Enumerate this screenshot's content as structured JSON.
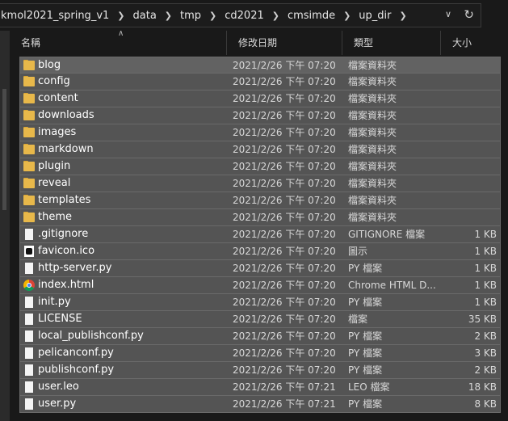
{
  "breadcrumb": [
    "kmol2021_spring_v1",
    "data",
    "tmp",
    "cd2021",
    "cmsimde",
    "up_dir"
  ],
  "columns": {
    "name": "名稱",
    "modified": "修改日期",
    "type": "類型",
    "size": "大小"
  },
  "files": [
    {
      "name": "blog",
      "modified": "2021/2/26 下午 07:20",
      "type": "檔案資料夾",
      "size": "",
      "icon": "folder-icon"
    },
    {
      "name": "config",
      "modified": "2021/2/26 下午 07:20",
      "type": "檔案資料夾",
      "size": "",
      "icon": "folder-icon"
    },
    {
      "name": "content",
      "modified": "2021/2/26 下午 07:20",
      "type": "檔案資料夾",
      "size": "",
      "icon": "folder-icon"
    },
    {
      "name": "downloads",
      "modified": "2021/2/26 下午 07:20",
      "type": "檔案資料夾",
      "size": "",
      "icon": "folder-icon"
    },
    {
      "name": "images",
      "modified": "2021/2/26 下午 07:20",
      "type": "檔案資料夾",
      "size": "",
      "icon": "folder-icon"
    },
    {
      "name": "markdown",
      "modified": "2021/2/26 下午 07:20",
      "type": "檔案資料夾",
      "size": "",
      "icon": "folder-icon"
    },
    {
      "name": "plugin",
      "modified": "2021/2/26 下午 07:20",
      "type": "檔案資料夾",
      "size": "",
      "icon": "folder-icon"
    },
    {
      "name": "reveal",
      "modified": "2021/2/26 下午 07:20",
      "type": "檔案資料夾",
      "size": "",
      "icon": "folder-icon"
    },
    {
      "name": "templates",
      "modified": "2021/2/26 下午 07:20",
      "type": "檔案資料夾",
      "size": "",
      "icon": "folder-icon"
    },
    {
      "name": "theme",
      "modified": "2021/2/26 下午 07:20",
      "type": "檔案資料夾",
      "size": "",
      "icon": "folder-icon"
    },
    {
      "name": ".gitignore",
      "modified": "2021/2/26 下午 07:20",
      "type": "GITIGNORE 檔案",
      "size": "1 KB",
      "icon": "file-icon"
    },
    {
      "name": "favicon.ico",
      "modified": "2021/2/26 下午 07:20",
      "type": "圖示",
      "size": "1 KB",
      "icon": "image-icon"
    },
    {
      "name": "http-server.py",
      "modified": "2021/2/26 下午 07:20",
      "type": "PY 檔案",
      "size": "1 KB",
      "icon": "file-icon"
    },
    {
      "name": "index.html",
      "modified": "2021/2/26 下午 07:20",
      "type": "Chrome HTML D...",
      "size": "1 KB",
      "icon": "chrome-icon"
    },
    {
      "name": "init.py",
      "modified": "2021/2/26 下午 07:20",
      "type": "PY 檔案",
      "size": "1 KB",
      "icon": "file-icon"
    },
    {
      "name": "LICENSE",
      "modified": "2021/2/26 下午 07:20",
      "type": "檔案",
      "size": "35 KB",
      "icon": "file-icon"
    },
    {
      "name": "local_publishconf.py",
      "modified": "2021/2/26 下午 07:20",
      "type": "PY 檔案",
      "size": "2 KB",
      "icon": "file-icon"
    },
    {
      "name": "pelicanconf.py",
      "modified": "2021/2/26 下午 07:20",
      "type": "PY 檔案",
      "size": "3 KB",
      "icon": "file-icon"
    },
    {
      "name": "publishconf.py",
      "modified": "2021/2/26 下午 07:20",
      "type": "PY 檔案",
      "size": "2 KB",
      "icon": "file-icon"
    },
    {
      "name": "user.leo",
      "modified": "2021/2/26 下午 07:21",
      "type": "LEO 檔案",
      "size": "18 KB",
      "icon": "file-icon"
    },
    {
      "name": "user.py",
      "modified": "2021/2/26 下午 07:21",
      "type": "PY 檔案",
      "size": "8 KB",
      "icon": "file-icon"
    }
  ]
}
